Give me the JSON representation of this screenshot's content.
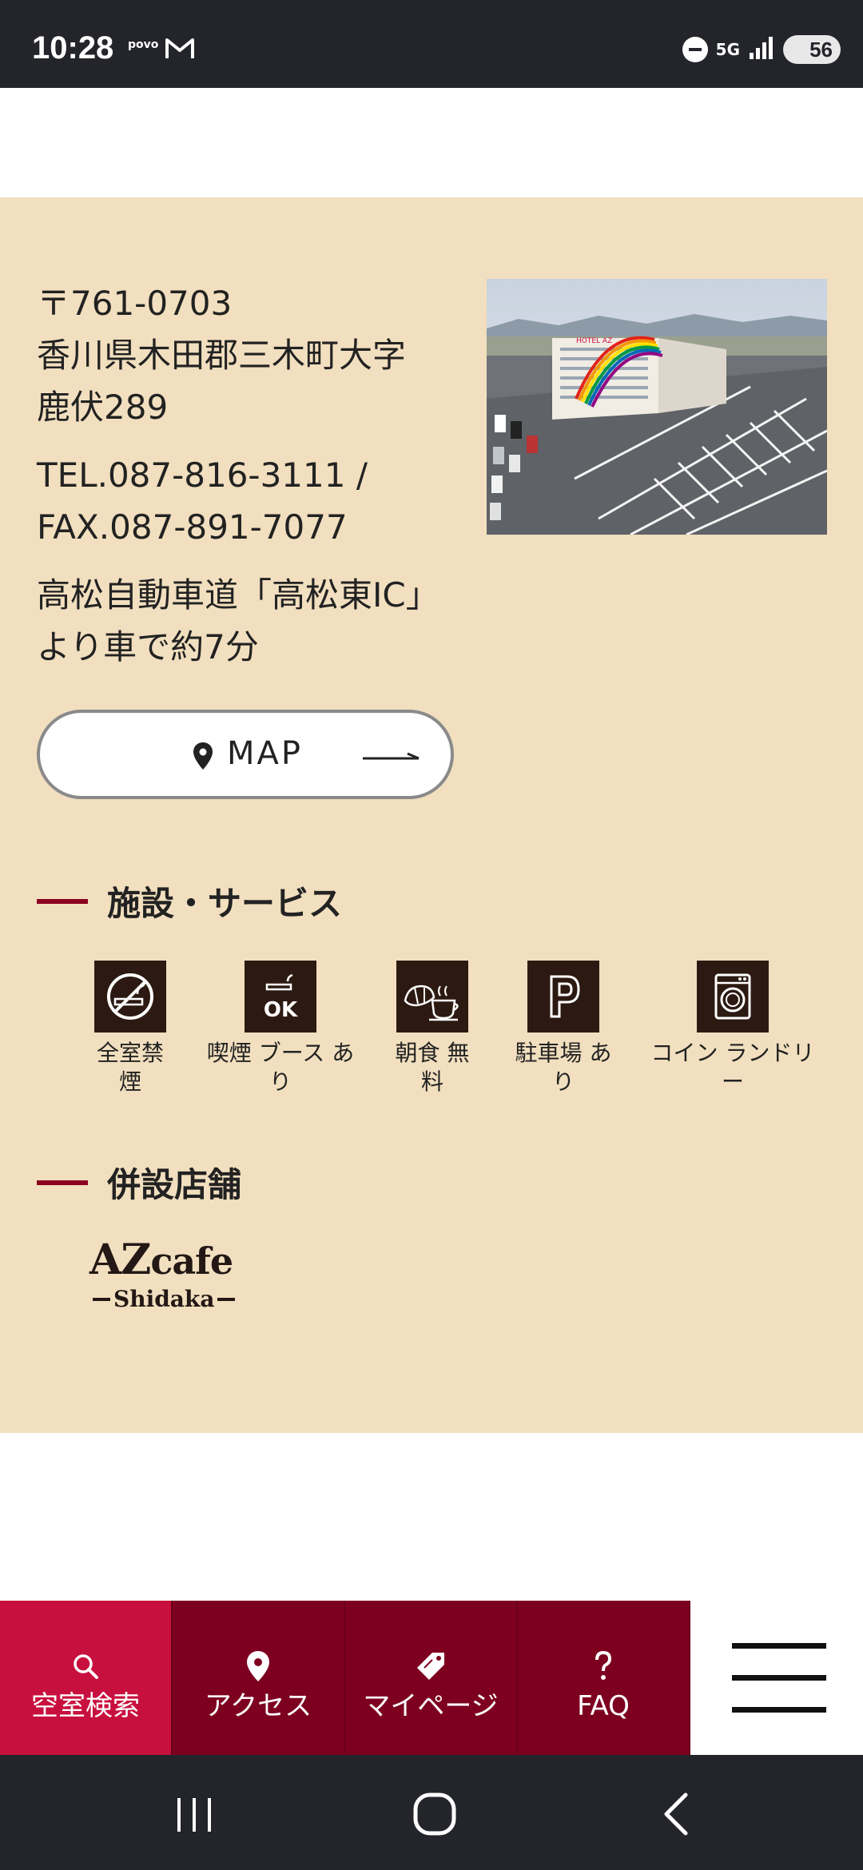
{
  "status_bar": {
    "time": "10:28",
    "carrier": "povo",
    "network": "5G",
    "battery": "56"
  },
  "hotel": {
    "postal": "〒761-0703",
    "address_line1": "香川県木田郡三木町大字",
    "address_line2": "鹿伏289",
    "tel_line1": "TEL.087-816-3111 /",
    "tel_line2": "FAX.087-891-7077",
    "access_line1": "高松自動車道「高松東IC」",
    "access_line2": "より車で約7分",
    "photo_sign": "HOTEL AZ"
  },
  "map_button": {
    "label": "MAP"
  },
  "facilities": {
    "heading": "施設・サービス",
    "items": [
      {
        "line1": "全室禁",
        "line2": "煙",
        "icon": "no-smoking-icon"
      },
      {
        "line1": "喫煙 ブース あ",
        "line2": "り",
        "icon": "smoking-ok-icon"
      },
      {
        "line1": "朝食 無",
        "line2": "料",
        "icon": "breakfast-icon"
      },
      {
        "line1": "駐車場 あ",
        "line2": "り",
        "icon": "parking-icon"
      },
      {
        "line1": "コイン ランドリ",
        "line2": "ー",
        "icon": "laundry-icon"
      }
    ]
  },
  "shops": {
    "heading": "併設店舗",
    "logo_main": "AZ",
    "logo_cafe": "cafe",
    "logo_sub": "Shidaka"
  },
  "bottom_nav": [
    {
      "label": "空室検索",
      "icon": "search-icon"
    },
    {
      "label": "アクセス",
      "icon": "location-pin-icon"
    },
    {
      "label": "マイページ",
      "icon": "tag-icon"
    },
    {
      "label": "FAQ",
      "icon": "question-icon"
    }
  ],
  "colors": {
    "beige": "#f1dfbf",
    "accent": "#8b0020",
    "nav": "#7d0020",
    "nav_active": "#c8103e"
  }
}
